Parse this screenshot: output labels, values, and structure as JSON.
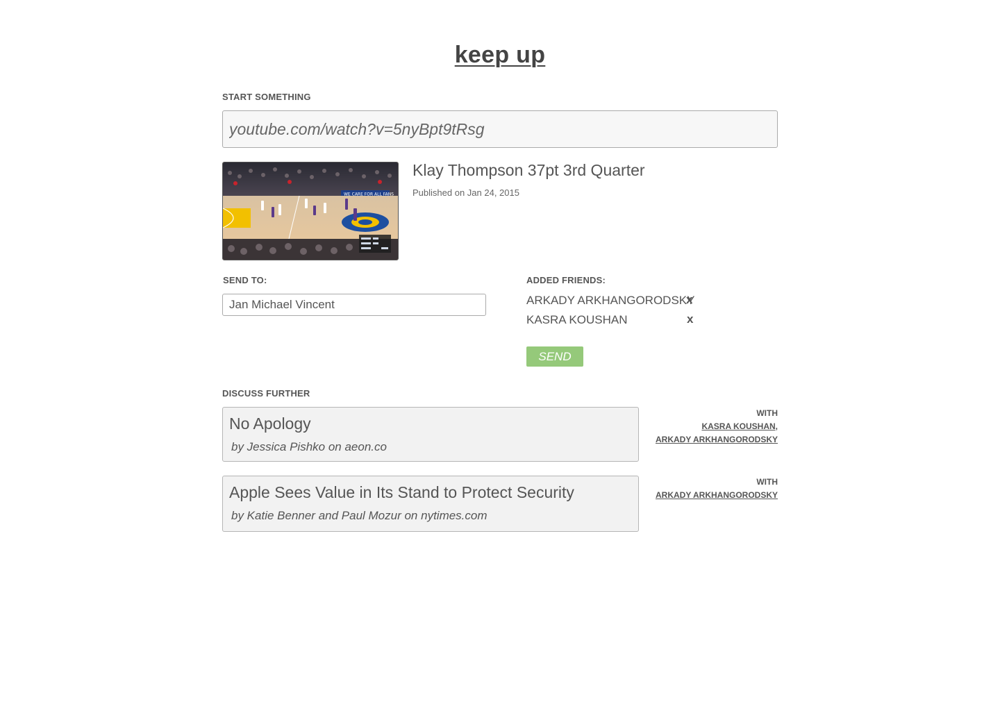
{
  "app": {
    "logo_text": "keep up"
  },
  "start": {
    "label": "START SOMETHING",
    "url_value": "youtube.com/watch?v=5nyBpt9tRsg"
  },
  "video": {
    "title": "Klay Thompson 37pt 3rd Quarter",
    "published": "Published on Jan 24, 2015",
    "thumbnail_banner": "WE CARE FOR ALL FANS"
  },
  "send_to": {
    "label": "SEND TO:",
    "input_value": "Jan Michael Vincent"
  },
  "added_friends": {
    "label": "ADDED FRIENDS:",
    "friends": [
      {
        "name": "ARKADY ARKHANGORODSKY",
        "remove": "x"
      },
      {
        "name": "KASRA KOUSHAN",
        "remove": "x"
      }
    ],
    "send_label": "SEND"
  },
  "discuss": {
    "label": "DISCUSS FURTHER",
    "items": [
      {
        "title": "No Apology",
        "byline": "by Jessica Pishko on aeon.co",
        "with_label": "WITH",
        "with_people": [
          "KASRA KOUSHAN,",
          "ARKADY ARKHANGORODSKY"
        ]
      },
      {
        "title": "Apple Sees Value in Its Stand to Protect Security",
        "byline": "by Katie Benner and Paul Mozur on nytimes.com",
        "with_label": "WITH",
        "with_people": [
          "ARKADY ARKHANGORODSKY"
        ]
      }
    ]
  },
  "colors": {
    "text": "#555555",
    "send_button": "#95c97a",
    "card_background": "#f2f2f2"
  }
}
